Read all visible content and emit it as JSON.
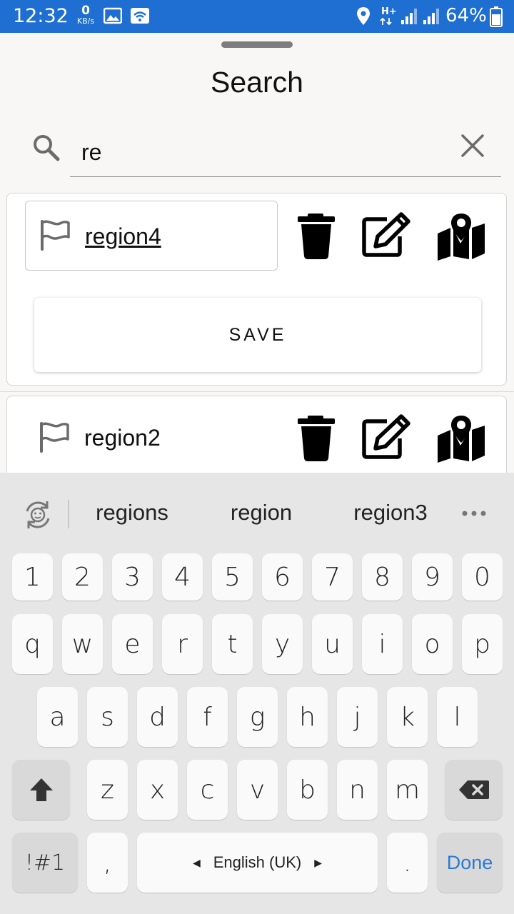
{
  "status_bar": {
    "time": "12:32",
    "net_speed_value": "0",
    "net_speed_unit": "KB/s",
    "network_type": "H+",
    "battery": "64%"
  },
  "sheet": {
    "title": "Search",
    "search": {
      "value": "re"
    },
    "results": [
      {
        "name": "region4",
        "save_label": "SAVE"
      },
      {
        "name": "region2"
      }
    ]
  },
  "keyboard": {
    "suggestions": [
      "regions",
      "region",
      "region3"
    ],
    "number_row": [
      "1",
      "2",
      "3",
      "4",
      "5",
      "6",
      "7",
      "8",
      "9",
      "0"
    ],
    "row1": [
      "q",
      "w",
      "e",
      "r",
      "t",
      "y",
      "u",
      "i",
      "o",
      "p"
    ],
    "row2": [
      "a",
      "s",
      "d",
      "f",
      "g",
      "h",
      "j",
      "k",
      "l"
    ],
    "row3": [
      "z",
      "x",
      "c",
      "v",
      "b",
      "n",
      "m"
    ],
    "symbols_label": "!#1",
    "comma": ",",
    "space_label": "English (UK)",
    "period": ".",
    "done_label": "Done"
  },
  "colors": {
    "status_bar": "#1e6fd1",
    "done": "#2a7ad6"
  }
}
